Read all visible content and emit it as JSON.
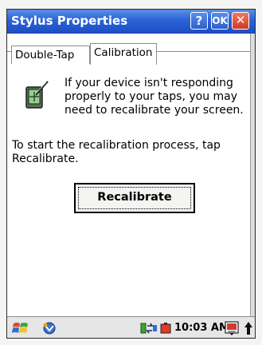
{
  "window": {
    "title": "Stylus Properties",
    "help_label": "?",
    "ok_label": "OK",
    "close_label": "✕"
  },
  "tabs": [
    {
      "label": "Double-Tap",
      "active": false
    },
    {
      "label": "Calibration",
      "active": true
    }
  ],
  "calibration": {
    "intro_text": "If your device isn't responding properly to your taps, you may need to recalibrate your screen.",
    "instruction_text": "To start the recalibration process, tap Recalibrate.",
    "button_label": "Recalibrate"
  },
  "taskbar": {
    "time": "10:03 AM"
  },
  "colors": {
    "title_bar": "#2c63d6",
    "close_button": "#cf3b22"
  },
  "icons": [
    "stylus-icon",
    "start-icon",
    "network-icon",
    "sync-icon",
    "battery-icon",
    "keyboard-icon",
    "up-arrow-icon"
  ]
}
